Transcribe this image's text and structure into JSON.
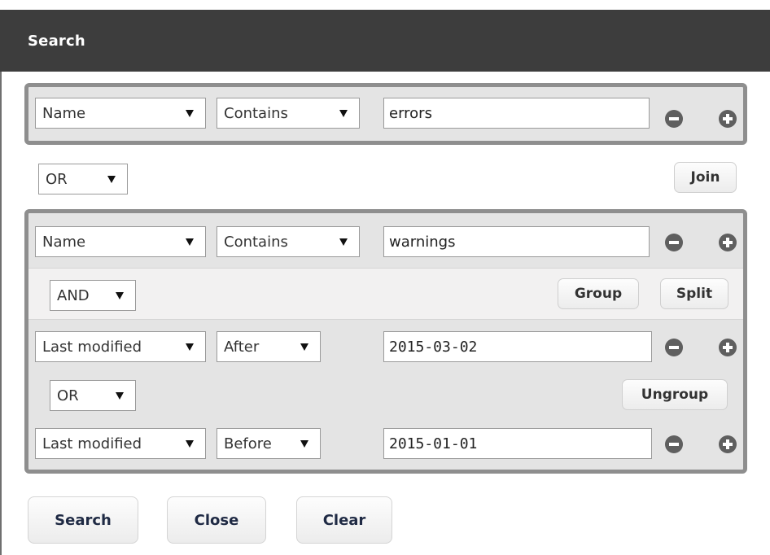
{
  "window": {
    "title": "Search"
  },
  "groups": [
    {
      "rows": [
        {
          "field": "Name",
          "operator": "Contains",
          "value": "errors"
        }
      ]
    },
    {
      "rows": [
        {
          "field": "Name",
          "operator": "Contains",
          "value": "warnings"
        },
        {
          "field": "Last modified",
          "operator": "After",
          "value": "2015-03-02"
        },
        {
          "field": "Last modified",
          "operator": "Before",
          "value": "2015-01-01"
        }
      ],
      "subgroup_connector": "AND",
      "subgroup_inner_connector": "OR",
      "group_button": "Group",
      "split_button": "Split",
      "ungroup_button": "Ungroup"
    }
  ],
  "between_groups": {
    "connector": "OR",
    "join_button": "Join"
  },
  "footer": {
    "search": "Search",
    "close": "Close",
    "clear": "Clear"
  },
  "colors": {
    "titlebar": "#3d3d3d",
    "group_border": "#8e8e8e",
    "group_bg": "#e4e4e4",
    "icon": "#5f5f5f"
  },
  "icons": {
    "remove": "minus-circle-icon",
    "add": "plus-circle-icon",
    "dropdown": "dropdown-arrow-icon"
  }
}
